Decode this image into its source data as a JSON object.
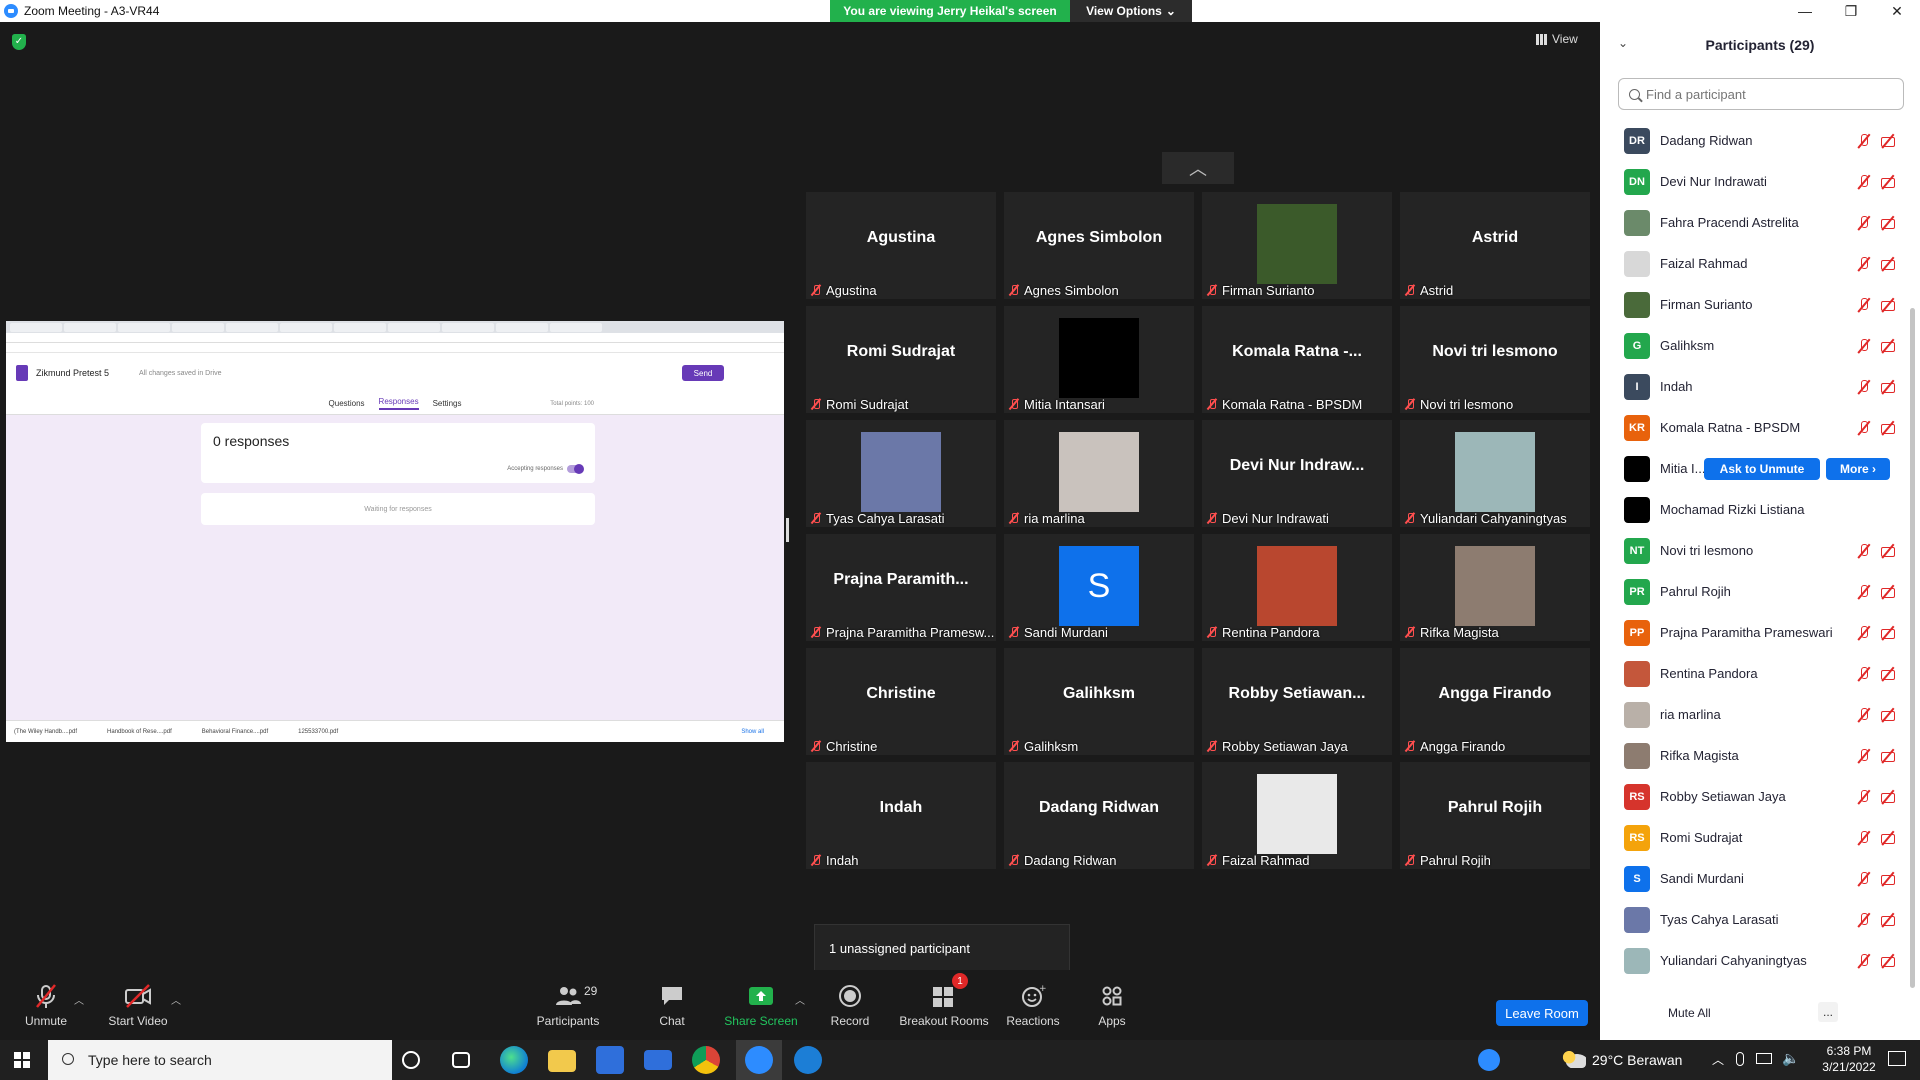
{
  "window": {
    "title": "Zoom Meeting - A3-VR44",
    "minimize": "—",
    "maximize": "❐",
    "close": "✕"
  },
  "banner": {
    "viewing": "You are viewing Jerry Heikal's screen",
    "view_options": "View Options"
  },
  "view_button": "View",
  "shared_screen": {
    "form_title": "Zikmund Pretest 5",
    "saved_status": "All changes saved in Drive",
    "send": "Send",
    "tabs": [
      "Questions",
      "Responses",
      "Settings"
    ],
    "total_points": "Total points: 100",
    "responses_count": "0 responses",
    "accepting": "Accepting responses",
    "waiting": "Waiting for responses",
    "downloads": [
      "(The Wiley Handb....pdf",
      "Handbook of Rese....pdf",
      "Behavioral Finance....pdf",
      "125533700.pdf"
    ],
    "show_all": "Show all"
  },
  "tiles": [
    {
      "big": "Agustina",
      "name": "Agustina",
      "photo": null
    },
    {
      "big": "Agnes Simbolon",
      "name": "Agnes Simbolon",
      "photo": null
    },
    {
      "big": "",
      "name": "Firman Surianto",
      "photo": "#3b5a2a"
    },
    {
      "big": "Astrid",
      "name": "Astrid",
      "photo": null
    },
    {
      "big": "Romi Sudrajat",
      "name": "Romi Sudrajat",
      "photo": null
    },
    {
      "big": "",
      "name": "Mitia Intansari",
      "photo": "#000000"
    },
    {
      "big": "Komala Ratna -...",
      "name": "Komala Ratna - BPSDM",
      "photo": null
    },
    {
      "big": "Novi tri lesmono",
      "name": "Novi tri lesmono",
      "photo": null
    },
    {
      "big": "",
      "name": "Tyas Cahya Larasati",
      "photo": "#6b78a8"
    },
    {
      "big": "",
      "name": "ria marlina",
      "photo": "#c9c2bd"
    },
    {
      "big": "Devi Nur Indraw...",
      "name": "Devi Nur Indrawati",
      "photo": null
    },
    {
      "big": "",
      "name": "Yuliandari Cahyaningtyas",
      "photo": "#9cb7b8"
    },
    {
      "big": "Prajna  Paramith...",
      "name": "Prajna Paramitha Pramesw...",
      "photo": null
    },
    {
      "big": "S",
      "name": "Sandi Murdani",
      "photo": "#0e71eb"
    },
    {
      "big": "",
      "name": "Rentina Pandora",
      "photo": "#b9472f"
    },
    {
      "big": "",
      "name": "Rifka Magista",
      "photo": "#8d7c70"
    },
    {
      "big": "Christine",
      "name": "Christine",
      "photo": null
    },
    {
      "big": "Galihksm",
      "name": "Galihksm",
      "photo": null
    },
    {
      "big": "Robby  Setiawan...",
      "name": "Robby Setiawan Jaya",
      "photo": null
    },
    {
      "big": "Angga Firando",
      "name": "Angga Firando",
      "photo": null
    },
    {
      "big": "Indah",
      "name": "Indah",
      "photo": null
    },
    {
      "big": "Dadang Ridwan",
      "name": "Dadang Ridwan",
      "photo": null
    },
    {
      "big": "",
      "name": "Faizal Rahmad",
      "photo": "#e9e9e9"
    },
    {
      "big": "Pahrul Rojih",
      "name": "Pahrul Rojih",
      "photo": null
    }
  ],
  "unassigned": "1 unassigned participant",
  "toolbar": {
    "unmute": "Unmute",
    "start_video": "Start Video",
    "participants": "Participants",
    "participants_count": "29",
    "chat": "Chat",
    "share_screen": "Share Screen",
    "record": "Record",
    "breakout_rooms": "Breakout Rooms",
    "breakout_badge": "1",
    "reactions": "Reactions",
    "apps": "Apps",
    "leave_room": "Leave Room"
  },
  "panel": {
    "title": "Participants (29)",
    "search_placeholder": "Find a participant",
    "ask_to_unmute": "Ask to Unmute",
    "more": "More ›",
    "mute_all": "Mute All",
    "more_dots": "...",
    "participants": [
      {
        "name": "Dadang Ridwan",
        "initials": "DR",
        "color": "#3b4a5e"
      },
      {
        "name": "Devi Nur Indrawati",
        "initials": "DN",
        "color": "#23a74d"
      },
      {
        "name": "Fahra Pracendi Astrelita",
        "initials": "",
        "color": "#6b8a6a"
      },
      {
        "name": "Faizal Rahmad",
        "initials": "",
        "color": "#d8d8d8"
      },
      {
        "name": "Firman Surianto",
        "initials": "",
        "color": "#4a6a3a"
      },
      {
        "name": "Galihksm",
        "initials": "G",
        "color": "#23a74d"
      },
      {
        "name": "Indah",
        "initials": "I",
        "color": "#3b4a5e"
      },
      {
        "name": "Komala Ratna - BPSDM",
        "initials": "KR",
        "color": "#e8620c"
      },
      {
        "name": "Mitia I...",
        "initials": "",
        "color": "#000000"
      },
      {
        "name": "Mochamad Rizki Listiana",
        "initials": "",
        "color": "#000000"
      },
      {
        "name": "Novi tri lesmono",
        "initials": "NT",
        "color": "#23a74d"
      },
      {
        "name": "Pahrul Rojih",
        "initials": "PR",
        "color": "#23a74d"
      },
      {
        "name": "Prajna Paramitha Prameswari",
        "initials": "PP",
        "color": "#e8620c"
      },
      {
        "name": "Rentina Pandora",
        "initials": "",
        "color": "#c4573b"
      },
      {
        "name": "ria marlina",
        "initials": "",
        "color": "#b9b0a8"
      },
      {
        "name": "Rifka Magista",
        "initials": "",
        "color": "#8d7c70"
      },
      {
        "name": "Robby Setiawan Jaya",
        "initials": "RS",
        "color": "#d6342c"
      },
      {
        "name": "Romi Sudrajat",
        "initials": "RS",
        "color": "#f4a30b"
      },
      {
        "name": "Sandi Murdani",
        "initials": "S",
        "color": "#0e71eb"
      },
      {
        "name": "Tyas Cahya Larasati",
        "initials": "",
        "color": "#6b78a8"
      },
      {
        "name": "Yuliandari Cahyaningtyas",
        "initials": "",
        "color": "#9cb7b8"
      }
    ]
  },
  "taskbar": {
    "search_placeholder": "Type here to search",
    "weather": "29°C  Berawan",
    "time": "6:38 PM",
    "date": "3/21/2022"
  }
}
